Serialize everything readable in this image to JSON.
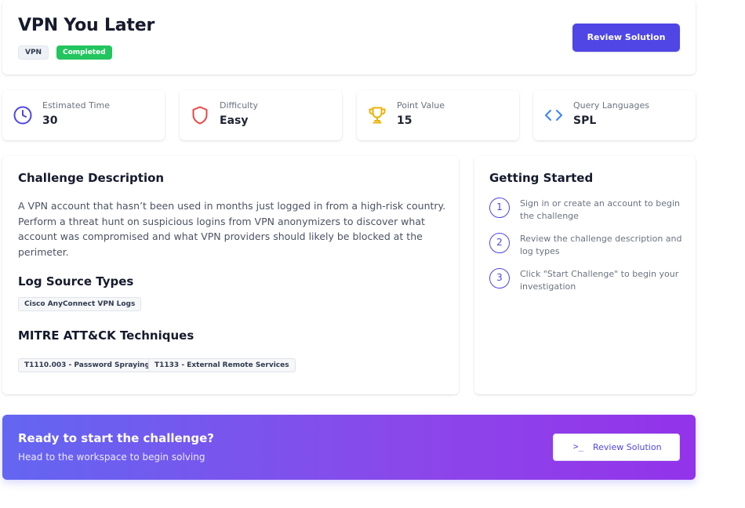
{
  "header": {
    "title": "VPN You Later",
    "badges": [
      "VPN",
      "Completed"
    ],
    "review_button": "Review Solution"
  },
  "stats": [
    {
      "label": "Estimated Time",
      "value": "30",
      "icon": "clock-icon"
    },
    {
      "label": "Difficulty",
      "value": "Easy",
      "icon": "shield-icon"
    },
    {
      "label": "Point Value",
      "value": "15",
      "icon": "trophy-icon"
    },
    {
      "label": "Query Languages",
      "value": "SPL",
      "icon": "code-icon"
    }
  ],
  "description": {
    "heading": "Challenge Description",
    "text": "A VPN account that hasn’t been used in months just logged in from a high-risk country. Perform a threat hunt on suspicious logins from VPN anonymizers to discover what account was compromised and what VPN providers should likely be blocked at the perimeter.",
    "log_heading": "Log Source Types",
    "log_sources": [
      "Cisco AnyConnect VPN Logs"
    ],
    "mitre_heading": "MITRE ATT&CK Techniques",
    "mitre_techniques": [
      "T1110.003 - Password Spraying",
      "T1133 - External Remote Services"
    ]
  },
  "getting_started": {
    "heading": "Getting Started",
    "steps": [
      {
        "num": "1",
        "text": "Sign in or create an account to begin the challenge"
      },
      {
        "num": "2",
        "text": "Review the challenge description and log types"
      },
      {
        "num": "3",
        "text": "Click \"Start Challenge\" to begin your investigation"
      }
    ]
  },
  "cta": {
    "title": "Ready to start the challenge?",
    "subtitle": "Head to the workspace to begin solving",
    "button_icon": ">_",
    "button_label": "Review Solution"
  },
  "colors": {
    "accent": "#4f46e5",
    "completed": "#22c55e",
    "difficulty": "#ef4444",
    "trophy": "#eab308",
    "code": "#3b82f6"
  }
}
